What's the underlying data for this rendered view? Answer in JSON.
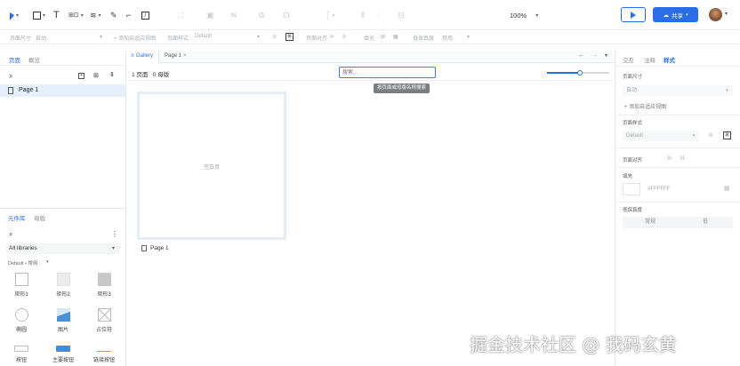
{
  "toolbar": {
    "zoom": "100%",
    "share_label": "共享",
    "colors": {
      "accent": "#2b6de6",
      "disabled": "#c9ccd1"
    }
  },
  "propbar": {
    "page_size_label": "页面尺寸",
    "page_size_value": "自动",
    "add_viewport": "+ 添加自适应视图",
    "page_style_label": "页面样式",
    "page_style_value": "Default",
    "page_align_label": "页面对齐",
    "fill_label": "填充",
    "low_fidelity_label": "低保真度",
    "low_fidelity_value": "禁用"
  },
  "left_panel": {
    "tab_pages": "页面",
    "tab_outline": "概览",
    "page_item": "Page 1",
    "tab_library": "元件库",
    "tab_masters": "母版",
    "library_select": "All libraries",
    "library_group": "Default • 常用",
    "items": [
      "矩形1",
      "矩形2",
      "矩形3",
      "椭圆",
      "图片",
      "占位符",
      "按钮",
      "主要按钮",
      "链接按钮"
    ]
  },
  "canvas": {
    "tab_gallery": "Gallery",
    "tab_page": "Page 1",
    "summary": "1 页面   0 母版",
    "search_placeholder": "搜索...",
    "tooltip": "按页面或母版名称搜索",
    "artboard_label": "空白页",
    "artboard_caption": "Page 1"
  },
  "right_panel": {
    "tab_interaction": "交互",
    "tab_notes": "注释",
    "tab_style": "样式",
    "page_size_title": "页面尺寸",
    "page_size_value": "自动",
    "add_viewport": "+ 添加自适应视图",
    "page_style_title": "页面样式",
    "page_style_value": "Default",
    "page_align_title": "页面对齐",
    "fill_title": "填充",
    "fill_value": "#FFFFFF",
    "low_fidelity_title": "低保真度",
    "btn_normal": "常规",
    "btn_low": "低"
  },
  "watermark": "掘金技术社区 @ 我码玄黄"
}
